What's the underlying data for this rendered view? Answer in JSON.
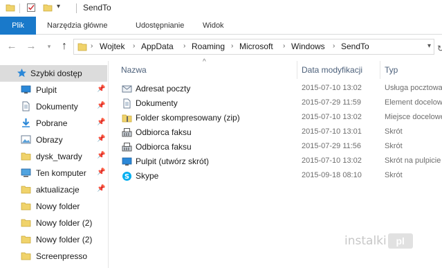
{
  "window": {
    "title": "SendTo"
  },
  "ribbon": {
    "tabs": [
      {
        "label": "Plik"
      },
      {
        "label": "Narzędzia główne"
      },
      {
        "label": "Udostępnianie"
      },
      {
        "label": "Widok"
      }
    ]
  },
  "address": {
    "crumbs": [
      "Wojtek",
      "AppData",
      "Roaming",
      "Microsoft",
      "Windows",
      "SendTo"
    ]
  },
  "sidebar": {
    "items": [
      {
        "label": "Szybki dostęp",
        "icon": "star-icon",
        "pinned": false
      },
      {
        "label": "Pulpit",
        "icon": "desktop-icon",
        "pinned": true
      },
      {
        "label": "Dokumenty",
        "icon": "documents-icon",
        "pinned": true
      },
      {
        "label": "Pobrane",
        "icon": "download-icon",
        "pinned": true
      },
      {
        "label": "Obrazy",
        "icon": "pictures-icon",
        "pinned": true
      },
      {
        "label": "dysk_twardy",
        "icon": "folder-icon",
        "pinned": true
      },
      {
        "label": "Ten komputer",
        "icon": "computer-icon",
        "pinned": true
      },
      {
        "label": "aktualizacje",
        "icon": "folder-icon",
        "pinned": true
      },
      {
        "label": "Nowy folder",
        "icon": "folder-icon",
        "pinned": false
      },
      {
        "label": "Nowy folder (2)",
        "icon": "folder-icon",
        "pinned": false
      },
      {
        "label": "Nowy folder (2)",
        "icon": "folder-icon",
        "pinned": false
      },
      {
        "label": "Screenpresso",
        "icon": "folder-icon",
        "pinned": false
      }
    ]
  },
  "table": {
    "columns": [
      "Nazwa",
      "Data modyfikacji",
      "Typ"
    ],
    "rows": [
      {
        "name": "Adresat poczty",
        "date": "2015-07-10 13:02",
        "type": "Usługa pocztowa",
        "icon": "mail-recipient-icon"
      },
      {
        "name": "Dokumenty",
        "date": "2015-07-29 11:59",
        "type": "Element docelowy",
        "icon": "documents-icon"
      },
      {
        "name": "Folder skompresowany (zip)",
        "date": "2015-07-10 13:02",
        "type": "Miejsce docelowe",
        "icon": "zip-folder-icon"
      },
      {
        "name": "Odbiorca faksu",
        "date": "2015-07-10 13:01",
        "type": "Skrót",
        "icon": "fax-icon"
      },
      {
        "name": "Odbiorca faksu",
        "date": "2015-07-29 11:56",
        "type": "Skrót",
        "icon": "fax-icon"
      },
      {
        "name": "Pulpit (utwórz skrót)",
        "date": "2015-07-10 13:02",
        "type": "Skrót na pulpicie",
        "icon": "desktop-icon"
      },
      {
        "name": "Skype",
        "date": "2015-09-18 08:10",
        "type": "Skrót",
        "icon": "skype-icon"
      }
    ]
  },
  "watermark": {
    "text": "instalki",
    "badge": "pl"
  },
  "colors": {
    "file_tab": "#1979ca",
    "folder": "#f0d36b",
    "selected": "#dcdcdc",
    "header_text": "#4c607a"
  }
}
